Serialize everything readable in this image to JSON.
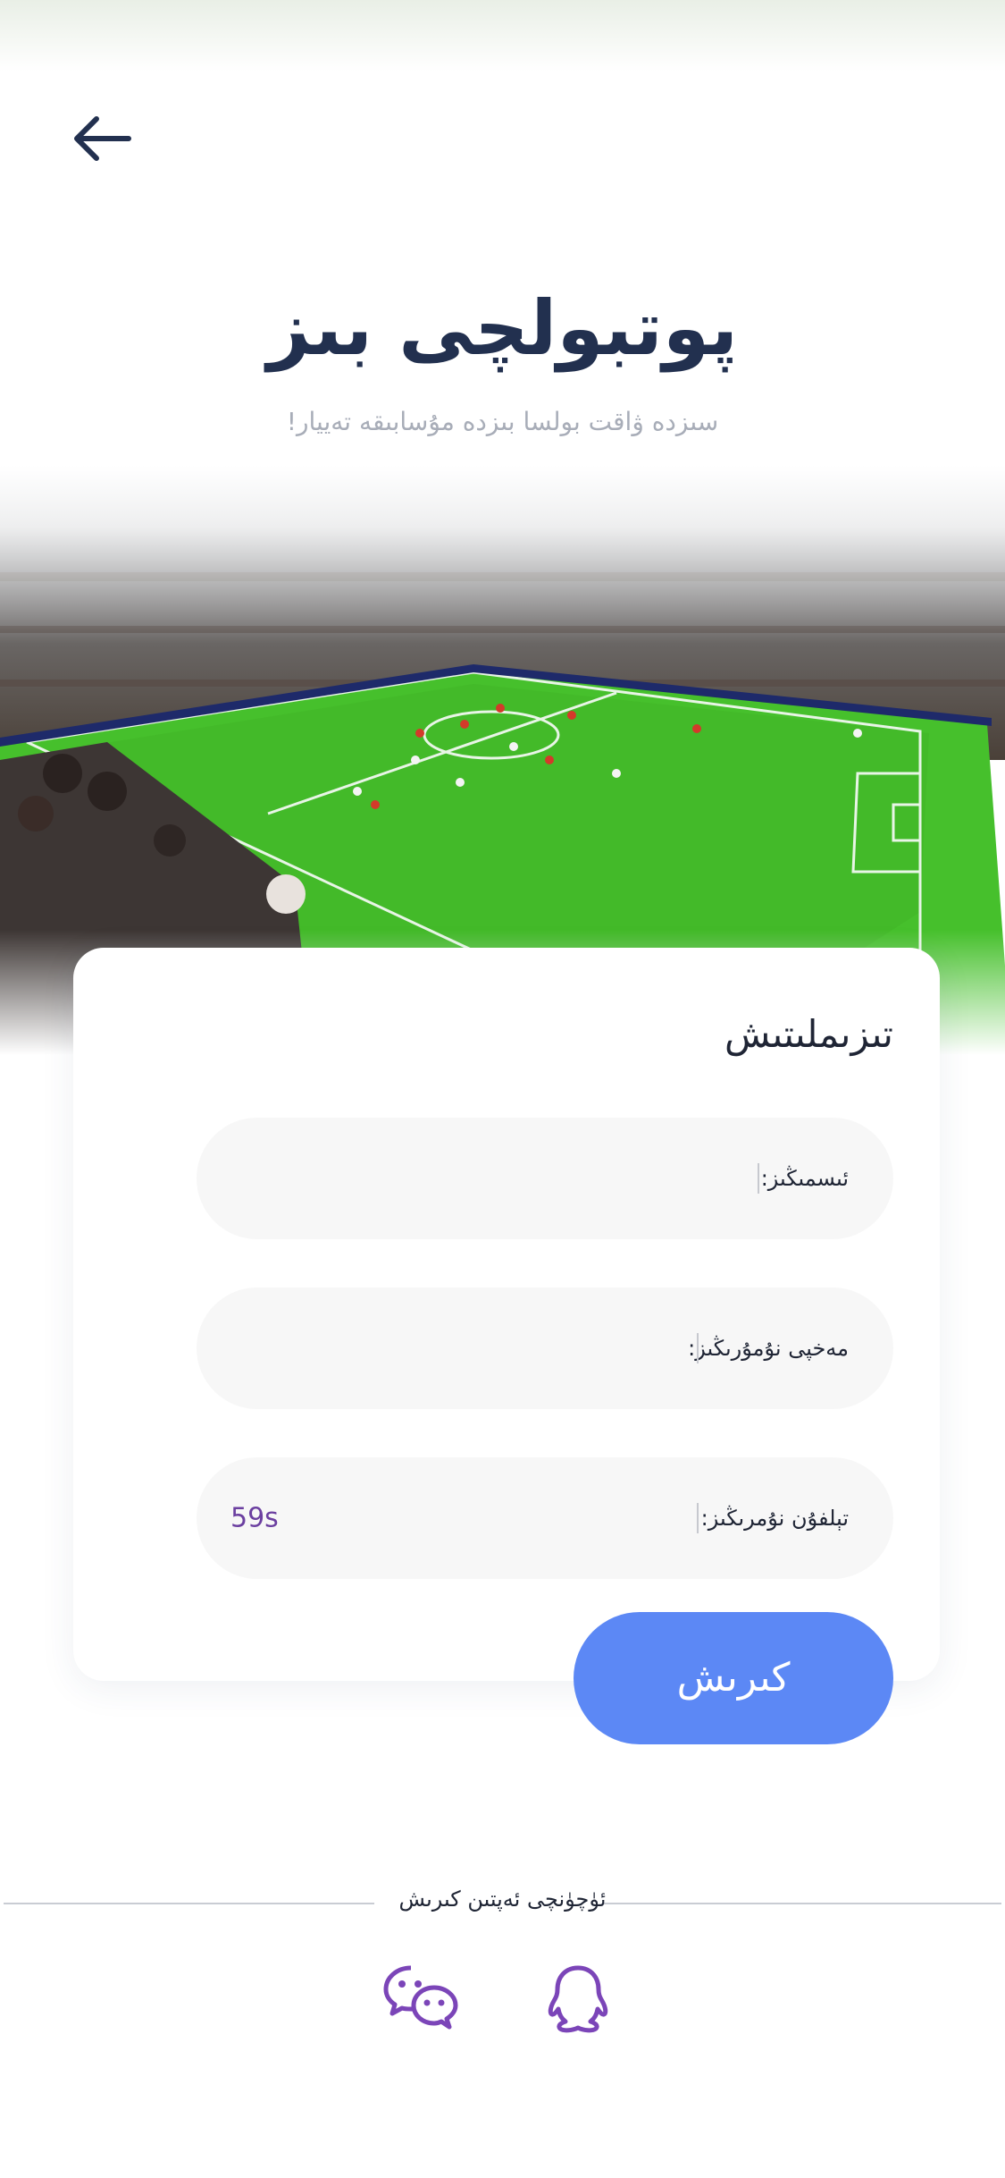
{
  "header": {
    "back_icon": "arrow-left-icon",
    "title": "پوتبولچى بىز",
    "subtitle": "سىزدە ۋاقت بولسا بىزدە مۇسابىقە تەييار!"
  },
  "form": {
    "title": "تىزىملىتىش",
    "fields": [
      {
        "label": "ئىسمىڭىز:",
        "value": ""
      },
      {
        "label": "مەخپى نۇمۇرىڭىز:",
        "value": ""
      },
      {
        "label": "تېلفۇن نۇمرىڭىز:",
        "value": "",
        "countdown": "59s"
      }
    ],
    "submit_label": "كىرىش"
  },
  "alt_login": {
    "label": "ئۈچۈنچى ئەپتىن كىرىش",
    "options": [
      {
        "name": "wechat",
        "icon": "wechat-icon"
      },
      {
        "name": "qq",
        "icon": "qq-icon"
      }
    ]
  },
  "colors": {
    "title": "#22304f",
    "accent_button": "#5c88f5",
    "icon_purple": "#7b45b8",
    "pitch_green": "#3fbf2a"
  }
}
